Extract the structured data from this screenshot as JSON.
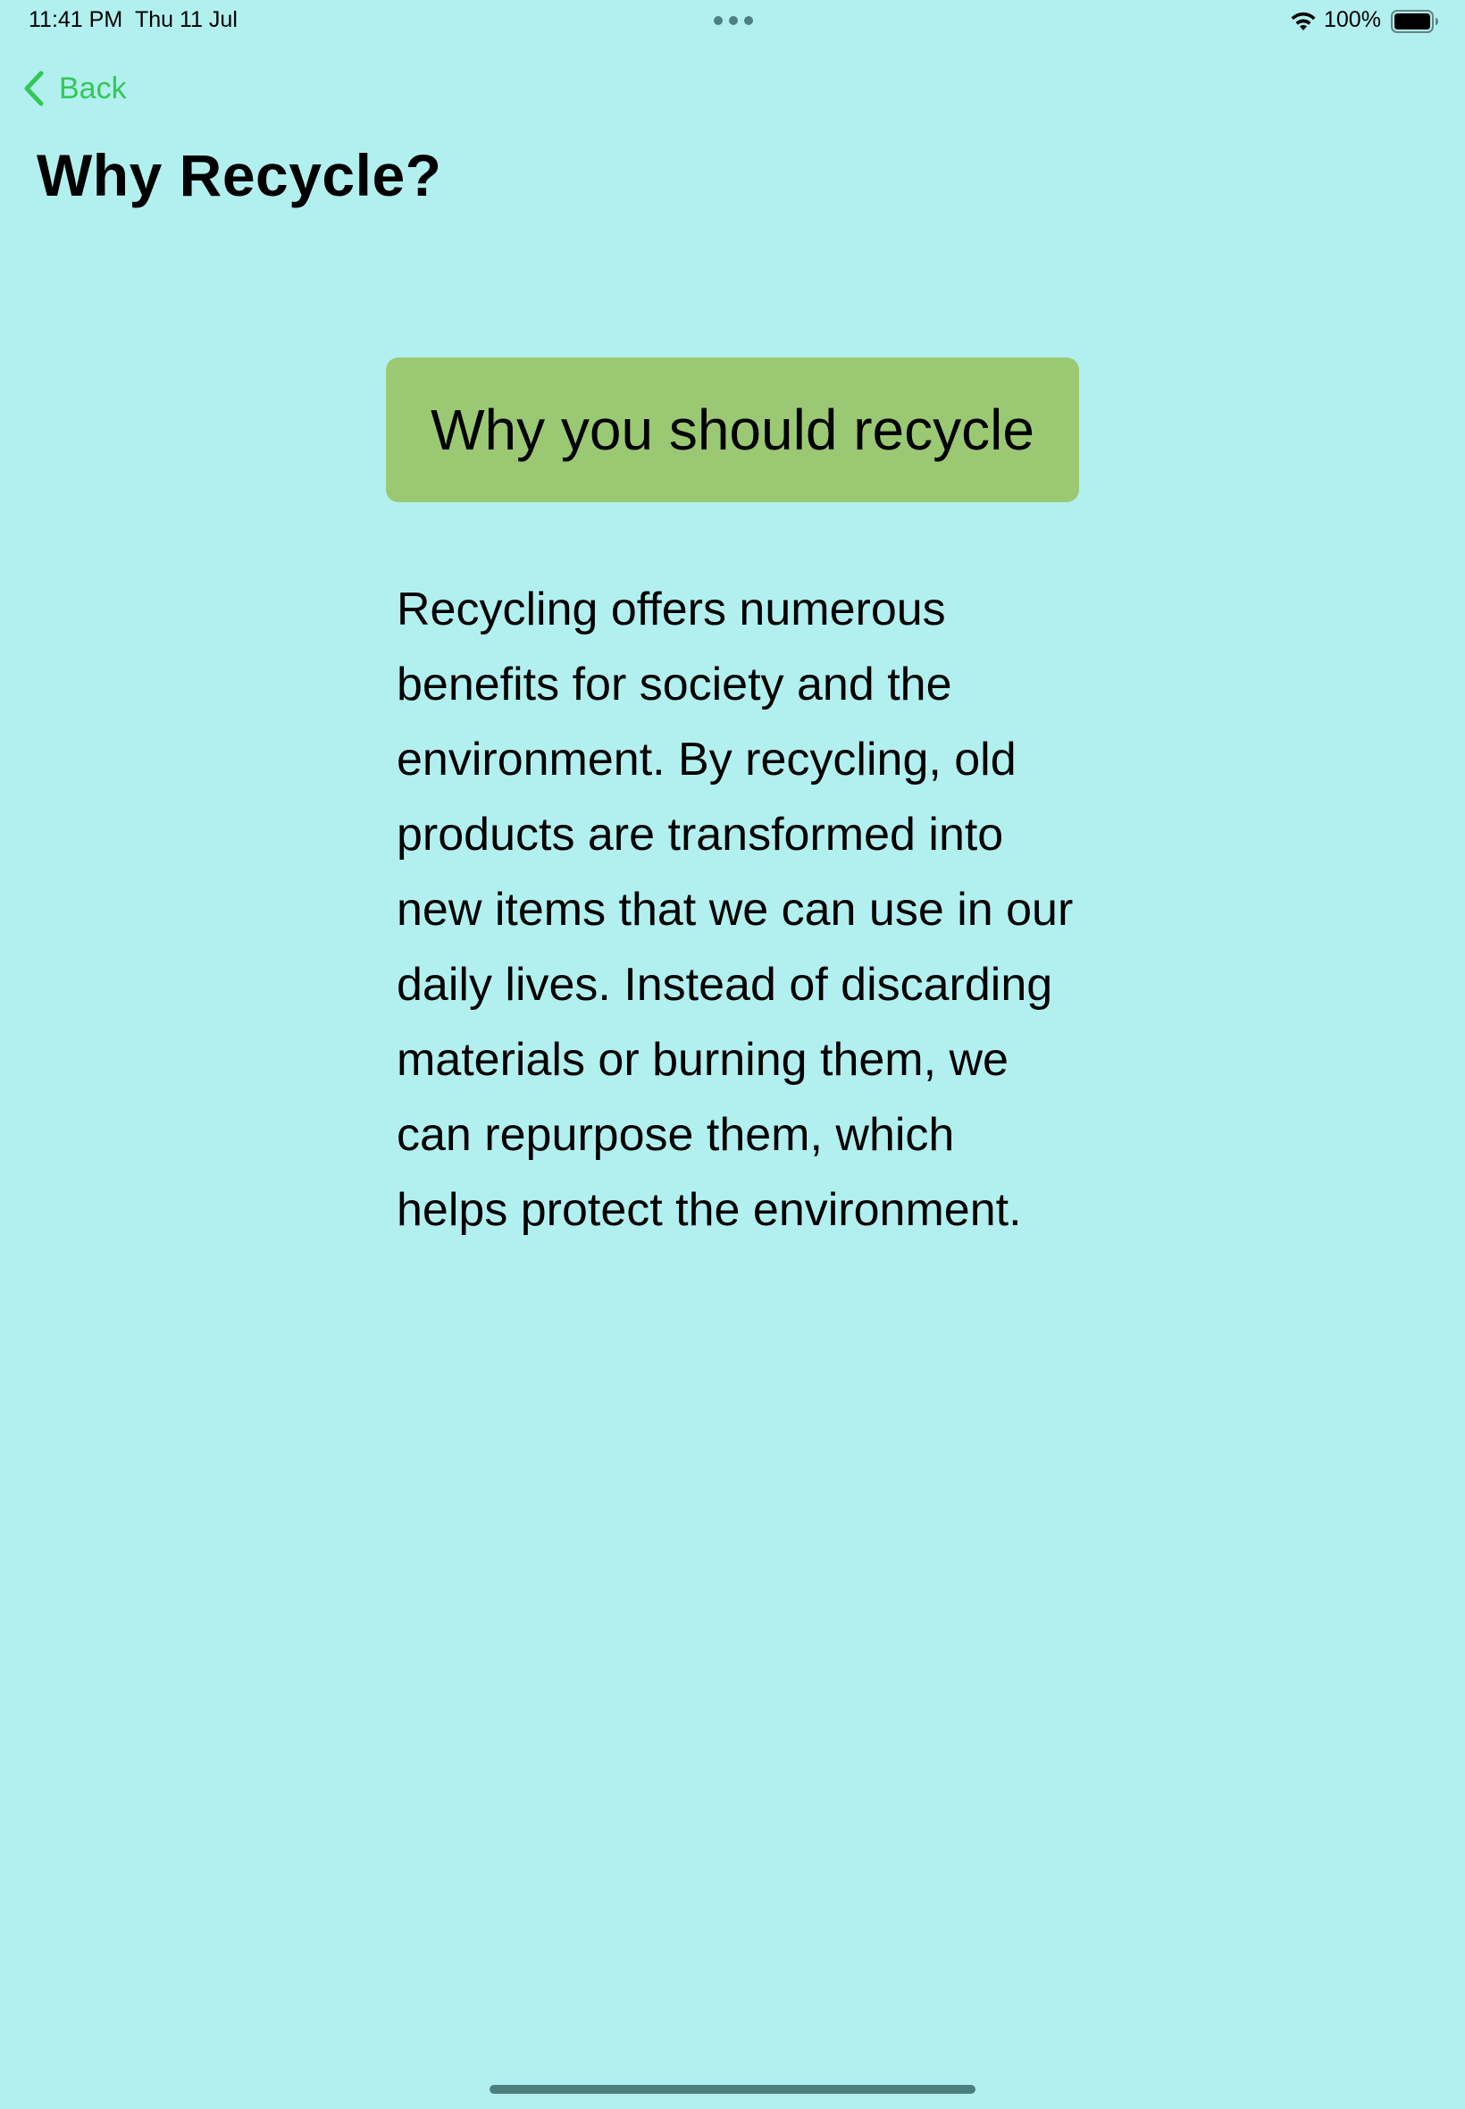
{
  "status_bar": {
    "time": "11:41 PM",
    "date": "Thu 11 Jul",
    "battery_percent": "100%",
    "battery_level": 1.0
  },
  "nav": {
    "back_label": "Back",
    "title": "Why Recycle?"
  },
  "content": {
    "heading": "Why you should recycle",
    "body": "Recycling offers numerous benefits for society and the environment. By recycling, old products are transformed into new items that we can use in our daily lives. Instead of discarding materials or burning them, we can repurpose them, which helps protect the environment."
  },
  "colors": {
    "background": "#b2f0ef",
    "accent": "#34c759",
    "card": "#9bc973"
  },
  "icons": {
    "back": "chevron-left-icon",
    "wifi": "wifi-icon",
    "battery": "battery-icon",
    "multitask": "more-dots-icon"
  }
}
